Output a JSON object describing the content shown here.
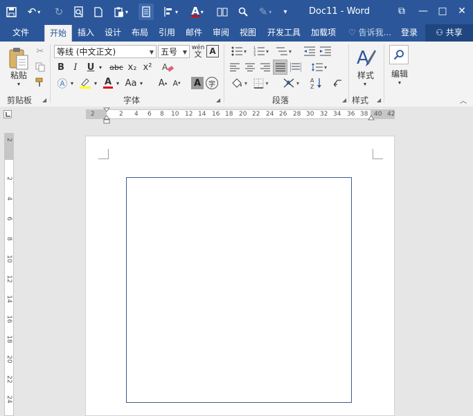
{
  "window": {
    "title": "Doc11 - Word",
    "buttons": {
      "restore": "⧉",
      "minimize": "—",
      "maximize": "□",
      "close": "✕"
    }
  },
  "tabs": [
    {
      "label": "文件"
    },
    {
      "label": "开始"
    },
    {
      "label": "插入"
    },
    {
      "label": "设计"
    },
    {
      "label": "布局"
    },
    {
      "label": "引用"
    },
    {
      "label": "邮件"
    },
    {
      "label": "审阅"
    },
    {
      "label": "视图"
    },
    {
      "label": "开发工具"
    },
    {
      "label": "加载项"
    }
  ],
  "tell_me": "告诉我...",
  "signin": "登录",
  "share": "共享",
  "ribbon": {
    "clipboard": {
      "label": "剪贴板",
      "paste": "粘贴"
    },
    "font": {
      "label": "字体",
      "font_name": "等线 (中文正文)",
      "font_size": "五号",
      "bold": "B",
      "italic": "I",
      "underline": "U",
      "strike": "abc",
      "subscript": "x₂",
      "superscript": "x²",
      "case": "Aa",
      "grow": "A",
      "shrink": "A",
      "text_a": "A",
      "phonetic": "wén"
    },
    "paragraph": {
      "label": "段落"
    },
    "styles": {
      "label": "样式",
      "button": "样式"
    },
    "editing": {
      "button": "编辑"
    }
  },
  "ruler": {
    "h_labels": [
      "2",
      "2",
      "4",
      "6",
      "8",
      "10",
      "12",
      "14",
      "16",
      "18",
      "20",
      "22",
      "24",
      "26",
      "28",
      "30",
      "32",
      "34",
      "36",
      "38",
      "40",
      "42"
    ],
    "v_labels": [
      "2",
      "2",
      "4",
      "6",
      "8",
      "10",
      "12",
      "14",
      "16",
      "18",
      "20",
      "22",
      "24"
    ]
  },
  "colors": {
    "brand": "#2b579a",
    "highlight": "#ffff00",
    "font_color": "#e00000"
  }
}
